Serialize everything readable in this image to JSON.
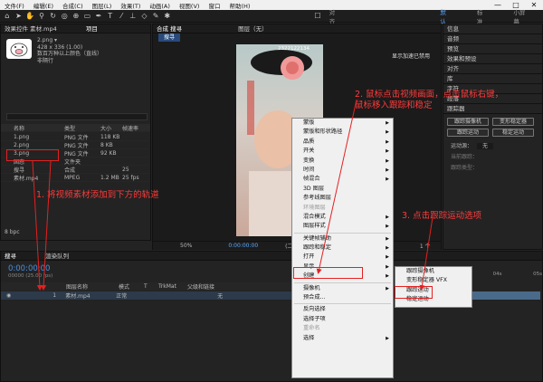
{
  "menubar": {
    "items": [
      "文件(F)",
      "编辑(E)",
      "合成(C)",
      "图层(L)",
      "效果(T)",
      "动画(A)",
      "视图(V)",
      "窗口",
      "帮助(H)"
    ],
    "min": "—",
    "max": "□",
    "close": "✕"
  },
  "toolbar": {
    "snap": "对齐",
    "workspaces": [
      "默认",
      "标准",
      "小屏幕"
    ]
  },
  "effects_tab": "效果控件 素材.mp4",
  "project_tab": "项目",
  "project": {
    "file_name": "2.png ▾",
    "file_dims": "428 x 336 (1.00)",
    "file_info": "数百万种以上颜色（直线）",
    "file_info2": "非隔行",
    "headers": [
      "名称",
      "类型",
      "大小",
      "帧速率"
    ],
    "items": [
      {
        "name": "1.png",
        "type": "PNG 文件",
        "size": "118 KB",
        "fps": ""
      },
      {
        "name": "2.png",
        "type": "PNG 文件",
        "size": "8 KB",
        "fps": ""
      },
      {
        "name": "3.png",
        "type": "PNG 文件",
        "size": "92 KB",
        "fps": ""
      },
      {
        "name": "固态",
        "type": "文件夹",
        "size": "",
        "fps": ""
      },
      {
        "name": "搜寻",
        "type": "合成",
        "size": "",
        "fps": "25"
      },
      {
        "name": "素材.mp4",
        "type": "MPEG",
        "size": "1.2 MB",
        "fps": "25 fps"
      }
    ],
    "bpc": "8 bpc"
  },
  "comp": {
    "tab": "合成 搜寻",
    "layer_tab": "图层（无）",
    "inner_tab": "搜寻",
    "gpu": "显示加速已禁用",
    "watermark": "2322122134",
    "zoom": "50%",
    "time": "0:00:00:00",
    "quality": "(二分之一)",
    "frames": "1 个"
  },
  "right_panel": {
    "items": [
      "信息",
      "音频",
      "预览",
      "效果和预设",
      "对齐",
      "库",
      "字符",
      "段落",
      "跟踪器"
    ],
    "tracker": {
      "btn1": "跟踪摄像机",
      "btn2": "变形稳定器",
      "btn3": "跟踪运动",
      "btn4": "稳定运动",
      "source_label": "运动源：",
      "source": "无",
      "current_label": "当前跟踪：",
      "track_type_label": "跟踪类型："
    }
  },
  "timeline": {
    "tab1": "搜寻",
    "tab2": "渲染队列",
    "time": "0:00:00:00",
    "frame_info": "00000 (25.00 fps)",
    "headers": [
      "图层名称",
      "模式",
      "T",
      "TrkMat",
      "父级和链接"
    ],
    "layer_no": "1",
    "layer_name": "素材.mp4",
    "layer_mode": "正常",
    "layer_parent": "无",
    "ruler": [
      "01s",
      "02s",
      "03s",
      "04s",
      "05s"
    ]
  },
  "context_menu": [
    {
      "label": "蒙版",
      "sub": true
    },
    {
      "label": "蒙版和形状路径",
      "sub": true
    },
    {
      "label": "品质",
      "sub": true
    },
    {
      "label": "开关",
      "sub": true
    },
    {
      "label": "变换",
      "sub": true
    },
    {
      "label": "时间",
      "sub": true
    },
    {
      "label": "帧混合",
      "sub": true
    },
    {
      "label": "3D 图层",
      "sub": false
    },
    {
      "label": "参考线图层",
      "sub": false
    },
    {
      "label": "环境图层",
      "sub": false,
      "dis": true
    },
    {
      "label": "混合模式",
      "sub": true
    },
    {
      "label": "图层样式",
      "sub": true
    },
    {
      "sep": true
    },
    {
      "label": "关键帧辅助",
      "sub": true
    },
    {
      "label": "跟踪和稳定",
      "sub": true
    },
    {
      "label": "打开",
      "sub": true
    },
    {
      "label": "显示",
      "sub": true
    },
    {
      "label": "创建",
      "sub": true
    },
    {
      "sep": true
    },
    {
      "label": "摄像机",
      "sub": true
    },
    {
      "label": "预合成...",
      "sub": false
    },
    {
      "sep": true
    },
    {
      "label": "反向选择",
      "sub": false
    },
    {
      "label": "选择子项",
      "sub": false
    },
    {
      "label": "重命名",
      "sub": false,
      "dis": true
    },
    {
      "label": "选择",
      "sub": true
    }
  ],
  "submenu": [
    {
      "label": "跟踪摄像机"
    },
    {
      "label": "变形稳定器 VFX"
    },
    {
      "label": "跟踪运动"
    },
    {
      "label": "稳定运动"
    }
  ],
  "annotations": {
    "a1": "1. 将视频素材添加到下方的轨道",
    "a2a": "2. 鼠标点击视频画面，点击鼠标右键，",
    "a2b": "鼠标移入跟踪和稳定",
    "a3": "3. 点击跟踪运动选项"
  },
  "colors": {
    "annotation": "#ff3b3b",
    "accent": "#5aa9ff",
    "timecode": "#4a8fe0"
  }
}
